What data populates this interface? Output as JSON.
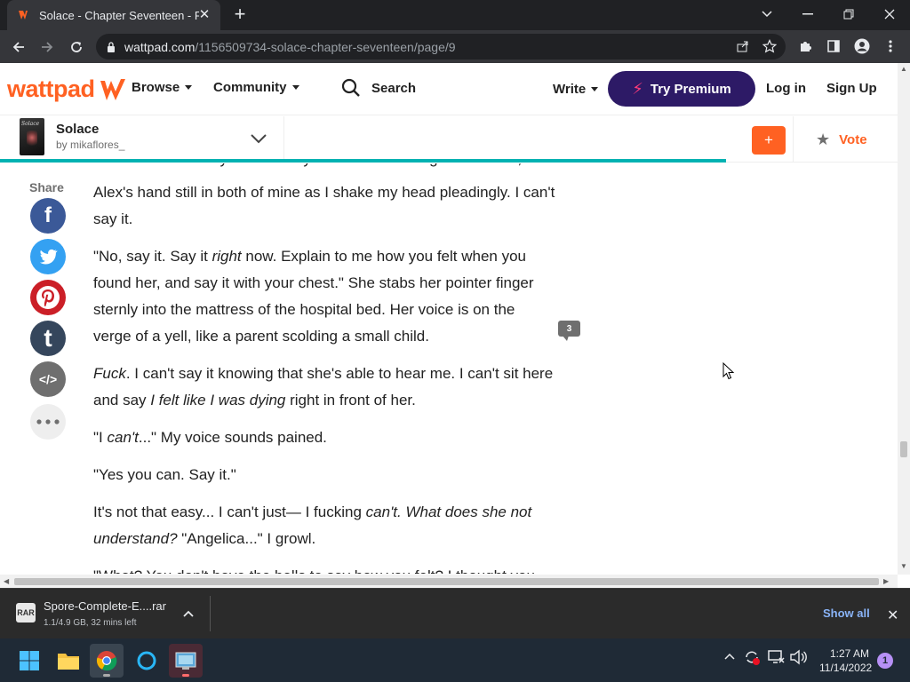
{
  "browser": {
    "tab_title": "Solace - Chapter Seventeen - Pag",
    "url_host": "wattpad.com",
    "url_path": "/1156509734-solace-chapter-seventeen/page/9"
  },
  "header": {
    "logo_text": "wattpad",
    "browse_label": "Browse",
    "community_label": "Community",
    "search_label": "Search",
    "write_label": "Write",
    "premium_label": "Try Premium",
    "login_label": "Log in",
    "signup_label": "Sign Up"
  },
  "story_bar": {
    "cover_text": "Solace",
    "title": "Solace",
    "author": "by mikaflores_",
    "add_label": "+",
    "vote_label": "Vote",
    "reading_progress": 0.8
  },
  "share": {
    "label": "Share",
    "buttons": [
      "facebook",
      "twitter",
      "pinterest",
      "tumblr",
      "embed",
      "more"
    ]
  },
  "story": {
    "cut_line": "\"Don't make me say it.\" I rest my elbows on the edge of the bed,",
    "p1": "Alex's hand still in both of mine as I shake my head pleadingly. I can't say it.",
    "p2a": "\"No, say it. Say it ",
    "p2b": "right",
    "p2c": " now. Explain to me how you felt when you found her, and say it with your chest.\" She stabs her pointer finger sternly into the mattress of the hospital bed. Her voice is on the verge of a yell, like a parent scolding a small child.",
    "p3a": "Fuck",
    "p3b": ". I can't say it knowing that she's able to hear me. I can't sit here and say ",
    "p3c": "I felt like I was dying",
    "p3d": " right in front of her.",
    "p4a": "\"I ",
    "p4b": "can't",
    "p4c": "...\" My voice sounds pained.",
    "p5": "\"Yes you can. Say it.\"",
    "p6a": "It's not that easy... I can't just— I fucking ",
    "p6b": "can't. What does she not understand?",
    "p6c": " \"Angelica...\" I growl.",
    "p7": "\"What? You don't have the balls to say how you felt? I thought you",
    "comment_count": "3"
  },
  "downloads": {
    "file_name": "Spore-Complete-E....rar",
    "status": "1.1/4.9 GB, 32 mins left",
    "show_all": "Show all"
  },
  "taskbar": {
    "time": "1:27 AM",
    "date": "11/14/2022",
    "notifications": "1"
  },
  "colors": {
    "brand": "#ff6122",
    "premium_bg": "#2d1a66",
    "progress": "#00b2b2"
  }
}
